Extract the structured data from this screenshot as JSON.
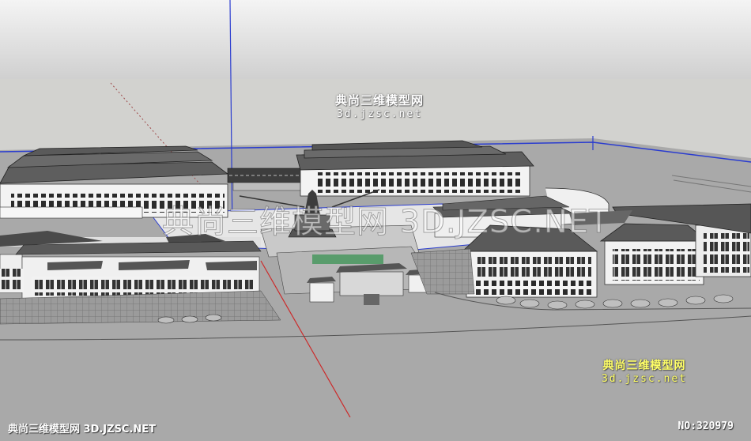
{
  "watermark_top": {
    "cn": "典尚三维模型网",
    "en": "3d.jzsc.net"
  },
  "watermark_center": "典尚三维模型网 3D.JZSC.NET",
  "watermark_bottom_right": {
    "cn": "典尚三维模型网",
    "en": "3d.jzsc.net"
  },
  "footer": {
    "left": "典尚三维模型网 3D.JZSC.NET",
    "right": "NO:320979"
  },
  "colors": {
    "sky_top": "#f2f2f2",
    "sky_bottom": "#c8c8c8",
    "ground": "#a8a8a8",
    "roof": "#5b5b5b",
    "wall": "#f4f4f4",
    "axis_blue": "#2a3ccf",
    "axis_red": "#cc2a2a"
  }
}
